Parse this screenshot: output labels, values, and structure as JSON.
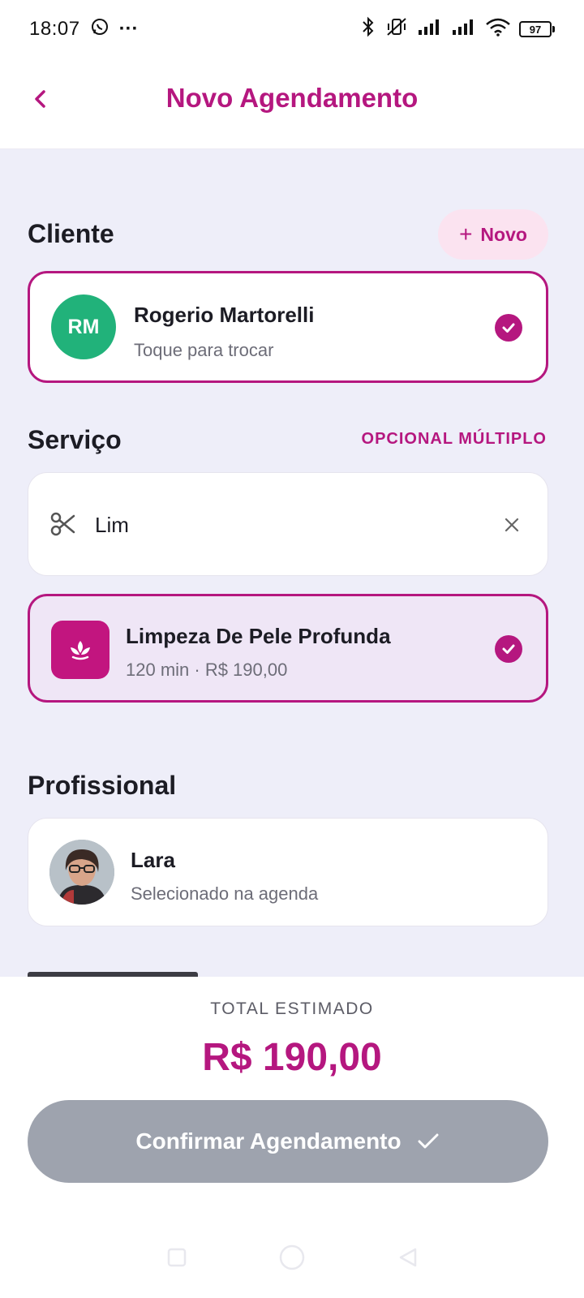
{
  "status_bar": {
    "time": "18:07",
    "more": "···",
    "battery": "97",
    "icons": [
      "whatsapp-icon",
      "bluetooth-icon",
      "vibrate-off-icon",
      "signal-icon",
      "signal-icon",
      "wifi-icon",
      "battery-icon"
    ]
  },
  "header": {
    "title": "Novo Agendamento",
    "back_icon": "chevron-left-icon"
  },
  "cliente": {
    "title": "Cliente",
    "new_label": "Novo",
    "selected": {
      "initials": "RM",
      "name": "Rogerio Martorelli",
      "hint": "Toque para trocar"
    }
  },
  "servico": {
    "title": "Serviço",
    "tag": "OPCIONAL MÚLTIPLO",
    "search_value": "Lim",
    "selected": {
      "name": "Limpeza De Pele Profunda",
      "meta": "120 min · R$ 190,00"
    }
  },
  "profissional": {
    "title": "Profissional",
    "name": "Lara",
    "hint": "Selecionado na agenda"
  },
  "footer": {
    "total_label": "TOTAL ESTIMADO",
    "total_value": "R$ 190,00",
    "confirm_label": "Confirmar Agendamento"
  },
  "colors": {
    "accent": "#b5177f",
    "accent_soft": "#fbe3f0",
    "avatar_green": "#21b27a",
    "background": "#eeeef9",
    "disabled_button": "#9ea3ae"
  }
}
